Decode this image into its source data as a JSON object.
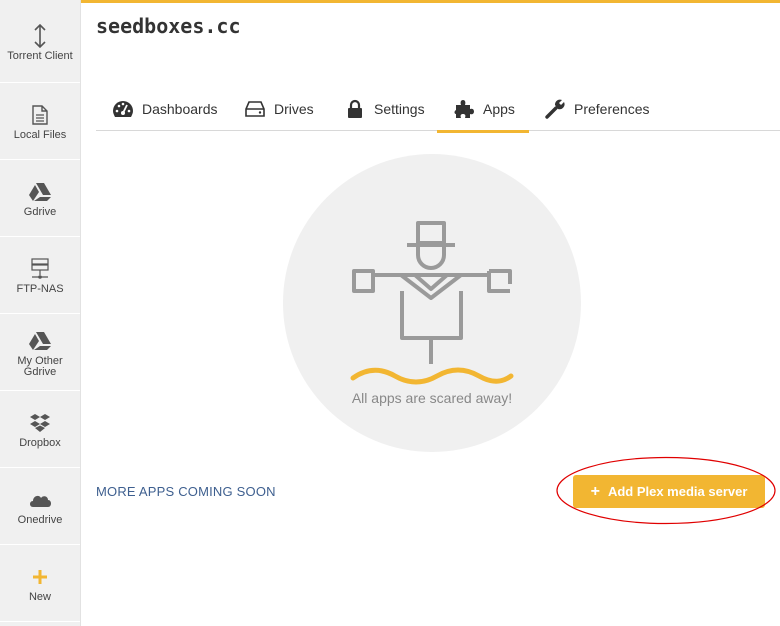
{
  "colors": {
    "accent": "#f2b632",
    "link": "#3e5f8f",
    "icon": "#555555",
    "annotation": "#e00000"
  },
  "brand": {
    "logo_text": "seedboxes.cc"
  },
  "sidebar": {
    "items": [
      {
        "label": "Torrent Client",
        "icon": "arrows-updown-icon"
      },
      {
        "label": "Local Files",
        "icon": "file-icon"
      },
      {
        "label": "Gdrive",
        "icon": "google-drive-icon"
      },
      {
        "label": "FTP-NAS",
        "icon": "server-icon"
      },
      {
        "label": "My Other Gdrive",
        "icon": "google-drive-icon"
      },
      {
        "label": "Dropbox",
        "icon": "dropbox-icon"
      },
      {
        "label": "Onedrive",
        "icon": "cloud-icon"
      },
      {
        "label": "New",
        "icon": "plus-icon"
      }
    ]
  },
  "tabs": [
    {
      "label": "Dashboards",
      "icon": "gauge-icon"
    },
    {
      "label": "Drives",
      "icon": "hard-drive-icon"
    },
    {
      "label": "Settings",
      "icon": "lock-icon"
    },
    {
      "label": "Apps",
      "icon": "puzzle-icon",
      "active": true
    },
    {
      "label": "Preferences",
      "icon": "wrench-icon"
    }
  ],
  "empty_state": {
    "message": "All apps are scared away!",
    "illustration": "scarecrow-illustration"
  },
  "footer": {
    "more_apps": "MORE APPS COMING SOON",
    "add_button": "Add Plex media server"
  }
}
